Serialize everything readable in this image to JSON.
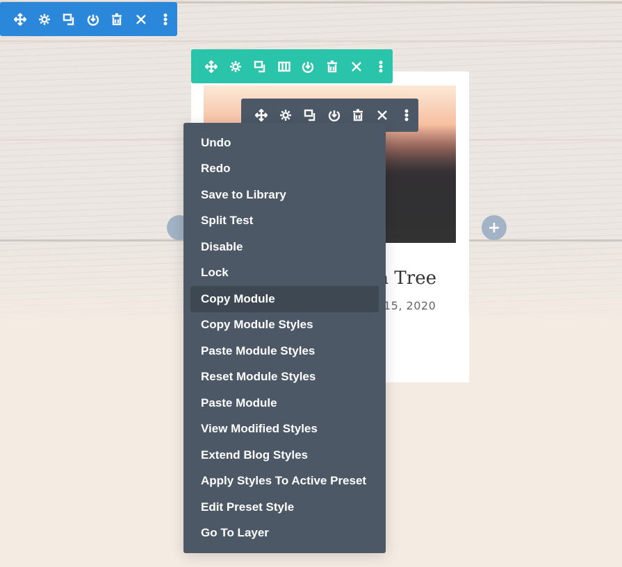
{
  "colors": {
    "section_toolbar": "#2b87da",
    "row_toolbar": "#29c4a9",
    "module_toolbar": "#4c5866",
    "menu_bg": "#4c5866",
    "menu_highlight": "#3e4853",
    "add_button": "#a2b3c6"
  },
  "section_toolbar": {
    "icons": [
      "move-icon",
      "settings-icon",
      "duplicate-icon",
      "save-icon",
      "delete-icon",
      "close-icon",
      "more-icon"
    ]
  },
  "row_toolbar": {
    "icons": [
      "move-icon",
      "settings-icon",
      "duplicate-icon",
      "columns-icon",
      "save-icon",
      "delete-icon",
      "close-icon",
      "more-icon"
    ]
  },
  "module_toolbar": {
    "icons": [
      "move-icon",
      "settings-icon",
      "duplicate-icon",
      "save-icon",
      "delete-icon",
      "close-icon",
      "more-icon"
    ]
  },
  "post": {
    "title_visible": "e a Tree",
    "date_visible": "15, 2020"
  },
  "add_button": {
    "label": "+"
  },
  "context_menu": {
    "highlighted": "Copy Module",
    "items": [
      "Undo",
      "Redo",
      "Save to Library",
      "Split Test",
      "Disable",
      "Lock",
      "Copy Module",
      "Copy Module Styles",
      "Paste Module Styles",
      "Reset Module Styles",
      "Paste Module",
      "View Modified Styles",
      "Extend Blog Styles",
      "Apply Styles To Active Preset",
      "Edit Preset Style",
      "Go To Layer"
    ]
  }
}
